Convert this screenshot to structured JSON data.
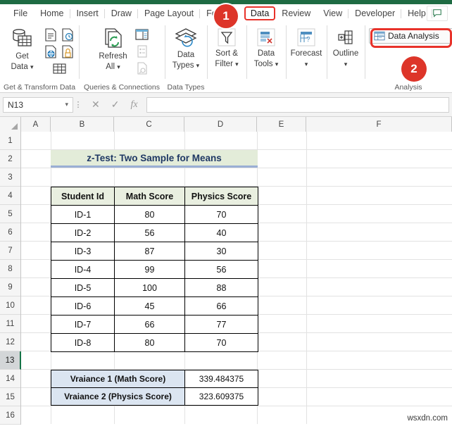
{
  "window": {
    "accent_green": "#1e6b43",
    "callout_red": "#dd3529"
  },
  "tabs": [
    {
      "label": "File",
      "active": false
    },
    {
      "label": "Home",
      "active": false
    },
    {
      "label": "Insert",
      "active": false
    },
    {
      "label": "Draw",
      "active": false
    },
    {
      "label": "Page Layout",
      "active": false
    },
    {
      "label": "For",
      "active": false
    },
    {
      "label": "Data",
      "active": true
    },
    {
      "label": "Review",
      "active": false
    },
    {
      "label": "View",
      "active": false
    },
    {
      "label": "Developer",
      "active": false
    },
    {
      "label": "Help",
      "active": false
    }
  ],
  "comment_button": {
    "icon": "comment-icon"
  },
  "ribbon": {
    "groups": [
      {
        "name": "Get & Transform Data",
        "label": "Get & Transform Data",
        "main_button": {
          "label_line1": "Get",
          "label_line2": "Data",
          "icon": "get-data-icon",
          "has_dropdown": true
        },
        "small_icons": [
          "from-text-icon",
          "from-recent-sources-icon",
          "from-web-icon",
          "from-table-icon",
          "existing-connections-icon"
        ]
      },
      {
        "name": "Queries & Connections",
        "label": "Queries & Connections",
        "main_button": {
          "label_line1": "Refresh",
          "label_line2": "All",
          "icon": "refresh-all-icon",
          "has_dropdown": true
        },
        "small_icons": [
          "queries-connections-icon",
          "properties-icon",
          "edit-links-icon"
        ]
      },
      {
        "name": "Data Types",
        "label": "Data Types",
        "main_button": {
          "label_line1": "Data",
          "label_line2": "Types",
          "icon": "data-types-icon",
          "has_dropdown": true
        },
        "small_icons": []
      },
      {
        "name": "Sort & Filter",
        "label": "",
        "main_button": {
          "label_line1": "Sort &",
          "label_line2": "Filter",
          "icon": "sort-filter-icon",
          "has_dropdown": true
        },
        "small_icons": []
      },
      {
        "name": "Data Tools",
        "label": "",
        "main_button": {
          "label_line1": "Data",
          "label_line2": "Tools",
          "icon": "data-tools-icon",
          "has_dropdown": true
        },
        "small_icons": []
      },
      {
        "name": "Forecast",
        "label": "",
        "main_button": {
          "label_line1": "Forecast",
          "label_line2": "",
          "icon": "forecast-icon",
          "has_dropdown": true
        },
        "small_icons": []
      },
      {
        "name": "Outline",
        "label": "",
        "main_button": {
          "label_line1": "Outline",
          "label_line2": "",
          "icon": "outline-icon",
          "has_dropdown": true
        },
        "small_icons": []
      },
      {
        "name": "Analysis",
        "label": "Analysis",
        "main_button": {
          "label_line1": "Data Analysis",
          "label_line2": "",
          "icon": "data-analysis-icon",
          "has_dropdown": false
        },
        "small_icons": []
      }
    ],
    "data_analysis_label": "Data Analysis"
  },
  "callouts": [
    {
      "number": "1",
      "target": "data-tab"
    },
    {
      "number": "2",
      "target": "data-analysis-button"
    }
  ],
  "formula_bar": {
    "name_box_value": "N13",
    "cancel_icon": "cancel-icon",
    "enter_icon": "check-icon",
    "function_icon": "fx-icon",
    "formula_value": "",
    "formula_placeholder": ""
  },
  "grid": {
    "columns": [
      "A",
      "B",
      "C",
      "D",
      "E",
      "F"
    ],
    "rows": [
      "1",
      "2",
      "3",
      "4",
      "5",
      "6",
      "7",
      "8",
      "9",
      "10",
      "11",
      "12",
      "13",
      "14",
      "15",
      "16"
    ],
    "selected_row": "13",
    "selected_cell": "N13"
  },
  "worksheet": {
    "title": "z-Test: Two Sample for Means",
    "table": {
      "headers": [
        "Student Id",
        "Math  Score",
        "Physics  Score"
      ],
      "rows": [
        [
          "ID-1",
          "80",
          "70"
        ],
        [
          "ID-2",
          "56",
          "40"
        ],
        [
          "ID-3",
          "87",
          "30"
        ],
        [
          "ID-4",
          "99",
          "56"
        ],
        [
          "ID-5",
          "100",
          "88"
        ],
        [
          "ID-6",
          "45",
          "66"
        ],
        [
          "ID-7",
          "66",
          "77"
        ],
        [
          "ID-8",
          "80",
          "70"
        ]
      ]
    },
    "variance": [
      {
        "label": "Vraiance 1 (Math Score)",
        "value": "339.484375"
      },
      {
        "label": "Vraiance 2 (Physics Score)",
        "value": "323.609375"
      }
    ]
  },
  "watermark": "wsxdn.com"
}
